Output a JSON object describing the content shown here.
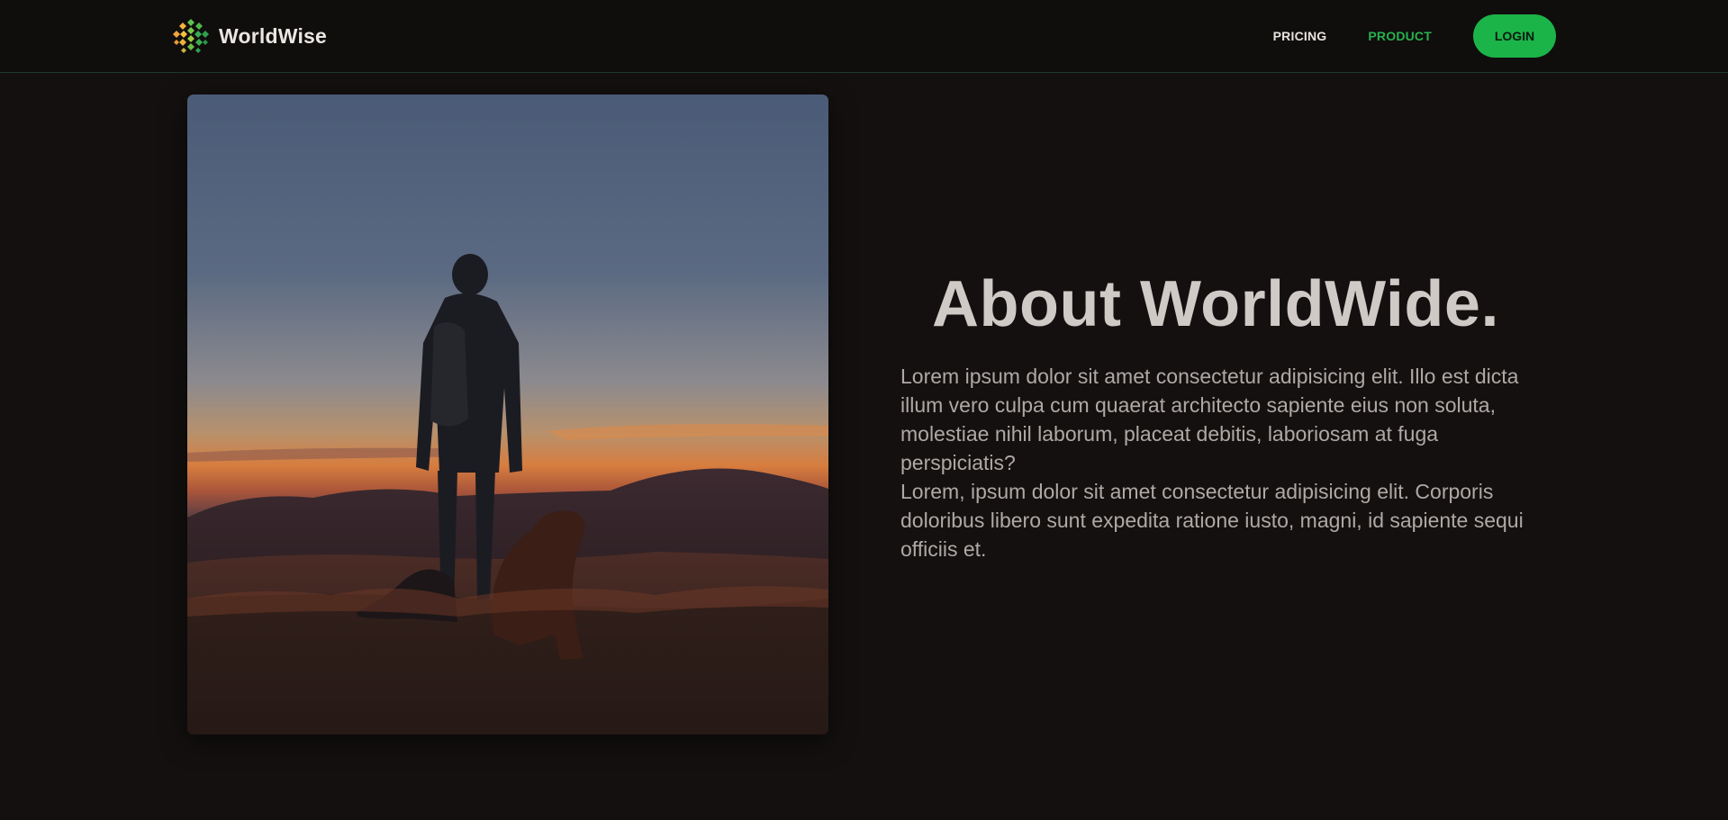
{
  "nav": {
    "logo_text": "WorldWise",
    "links": [
      {
        "label": "PRICING"
      },
      {
        "label": "PRODUCT"
      }
    ],
    "login_label": "LOGIN"
  },
  "hero": {
    "image_icon": "landscape-photo-icon"
  },
  "about": {
    "title": "About WorldWide.",
    "paragraphs": [
      "Lorem ipsum dolor sit amet consectetur adipisicing elit. Illo est dicta illum vero culpa cum quaerat architecto sapiente eius non soluta, molestiae nihil laborum, placeat debitis, laboriosam at fuga perspiciatis?",
      "Lorem, ipsum dolor sit amet consectetur adipisicing elit. Corporis doloribus libero sunt expedita ratione iusto, magni, id sapiente sequi officiis et."
    ]
  },
  "colors": {
    "background": "#141010",
    "accent": "#1bb448",
    "active_link": "#28b14d",
    "title": "#cfcac6",
    "body": "#aea9a5"
  }
}
